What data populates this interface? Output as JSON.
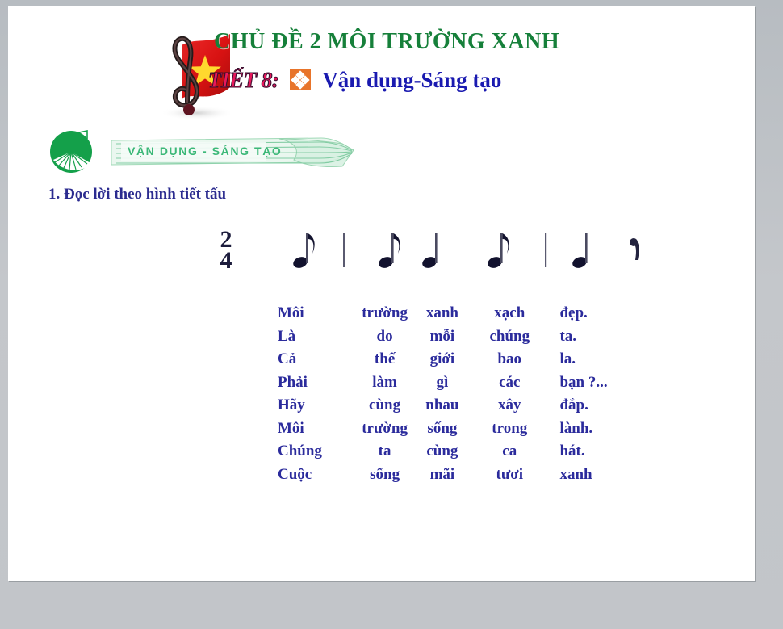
{
  "slide": {
    "title": "CHỦ ĐỀ 2 MÔI TRƯỜNG XANH",
    "lesson_label": "TIẾT 8:",
    "subtitle": "Vận dụng-Sáng tạo",
    "banner_label": "VẬN DỤNG - SÁNG TẠO",
    "section_heading": "1. Đọc lời theo hình tiết tấu"
  },
  "colors": {
    "title_green": "#16803a",
    "lesson_pink": "#e8185c",
    "subtitle_blue": "#1a1ab0",
    "bullet_orange": "#e8742a",
    "banner_green": "#3cb878",
    "lyrics_blue": "#2b2b9c",
    "heading_navy": "#2b2b8f",
    "slide_background": "#ffffff",
    "frame_gray": "#c3c6ca"
  },
  "icons": {
    "treble_clef": "treble-clef-icon",
    "vietnam_flag": "vietnam-flag-icon",
    "diamond_bullet": "diamond-bullet-icon",
    "piano_circle": "piano-circle-icon",
    "ribbon": "ribbon-icon"
  },
  "notation": {
    "time_signature": "2/4",
    "time_signature_top": "2",
    "time_signature_bottom": "4",
    "symbols": [
      {
        "type": "time-signature",
        "label": "2/4"
      },
      {
        "type": "eighth-note",
        "label": "♪"
      },
      {
        "type": "barline",
        "label": "|"
      },
      {
        "type": "eighth-note",
        "label": "♪"
      },
      {
        "type": "quarter-note",
        "label": "♩"
      },
      {
        "type": "eighth-note",
        "label": "♪"
      },
      {
        "type": "barline",
        "label": "|"
      },
      {
        "type": "quarter-note",
        "label": "♩"
      },
      {
        "type": "eighth-rest",
        "label": "𝄾"
      }
    ]
  },
  "lyrics": {
    "rows": [
      [
        "Môi",
        "trường",
        "xanh",
        "xạch",
        "đẹp."
      ],
      [
        "Là",
        "do",
        "mỗi",
        "chúng",
        "ta."
      ],
      [
        "Cả",
        "thế",
        "giới",
        "bao",
        "la."
      ],
      [
        "Phải",
        "làm",
        "gì",
        "các",
        "bạn ?..."
      ],
      [
        "Hãy",
        "cùng",
        "nhau",
        "xây",
        "đắp."
      ],
      [
        "Môi",
        "trường",
        "sống",
        "trong",
        "lành."
      ],
      [
        "Chúng",
        "ta",
        "cùng",
        "ca",
        "hát."
      ],
      [
        "Cuộc",
        "sống",
        "mãi",
        "tươi",
        "xanh"
      ]
    ]
  }
}
